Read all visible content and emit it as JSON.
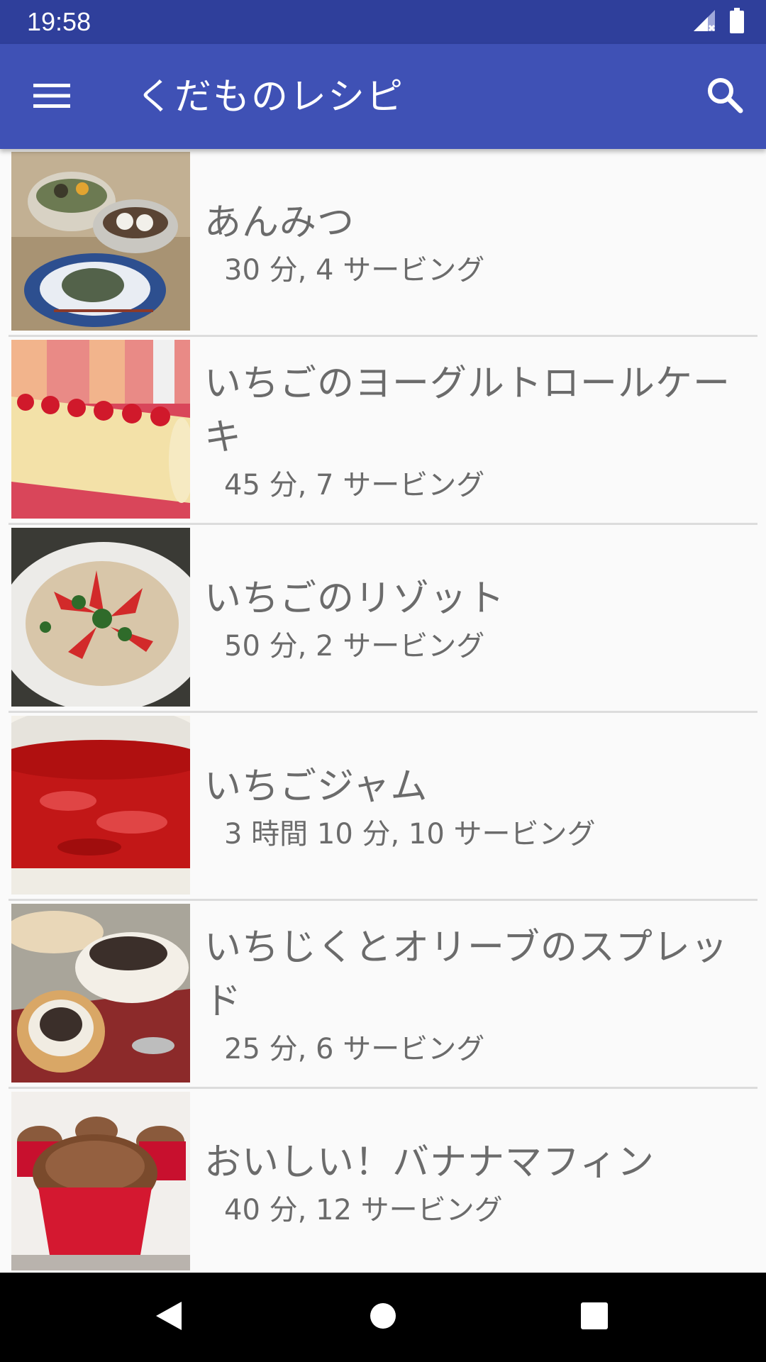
{
  "status_bar": {
    "time": "19:58",
    "icons": [
      "signal-icon",
      "battery-icon"
    ]
  },
  "app_bar": {
    "title": "くだものレシピ",
    "menu_icon": "hamburger-menu-icon",
    "search_icon": "search-icon",
    "color": "#3f51b5"
  },
  "recipes": [
    {
      "title": "あんみつ",
      "meta": "30 分, 4 サービング"
    },
    {
      "title": "いちごのヨーグルトロールケーキ",
      "meta": "45 分, 7 サービング"
    },
    {
      "title": "いちごのリゾット",
      "meta": "50 分, 2 サービング"
    },
    {
      "title": "いちごジャム",
      "meta": "3 時間 10 分, 10 サービング"
    },
    {
      "title": "いちじくとオリーブのスプレッド",
      "meta": "25 分, 6 サービング"
    },
    {
      "title": "おいしい！バナナマフィン",
      "meta": "40 分, 12 サービング"
    }
  ],
  "nav_bar": {
    "icons": [
      "back-icon",
      "home-icon",
      "recents-icon"
    ]
  }
}
